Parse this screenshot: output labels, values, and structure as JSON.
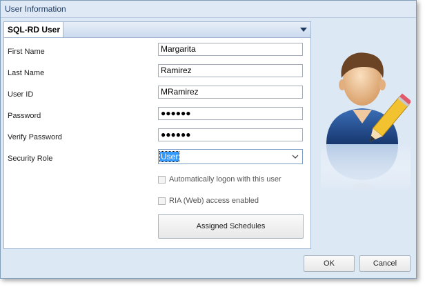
{
  "window": {
    "title": "User Information"
  },
  "tab": {
    "label": "SQL-RD User"
  },
  "form": {
    "first_name_label": "First Name",
    "first_name_value": "Margarita",
    "last_name_label": "Last Name",
    "last_name_value": "Ramirez",
    "user_id_label": "User ID",
    "user_id_value": "MRamirez",
    "password_label": "Password",
    "password_value": "●●●●●●",
    "verify_password_label": "Verify Password",
    "verify_password_value": "●●●●●●",
    "security_role_label": "Security Role",
    "security_role_value": "User",
    "auto_logon_label": "Automatically logon with this user",
    "auto_logon_checked": false,
    "ria_label": "RIA (Web) access enabled",
    "ria_checked": false,
    "assigned_schedules_label": "Assigned Schedules"
  },
  "footer": {
    "ok_label": "OK",
    "cancel_label": "Cancel"
  },
  "icons": {
    "user_edit": "user-with-pencil-icon",
    "tab_menu": "triangle-down-icon",
    "select_chev": "chevron-down-icon"
  }
}
